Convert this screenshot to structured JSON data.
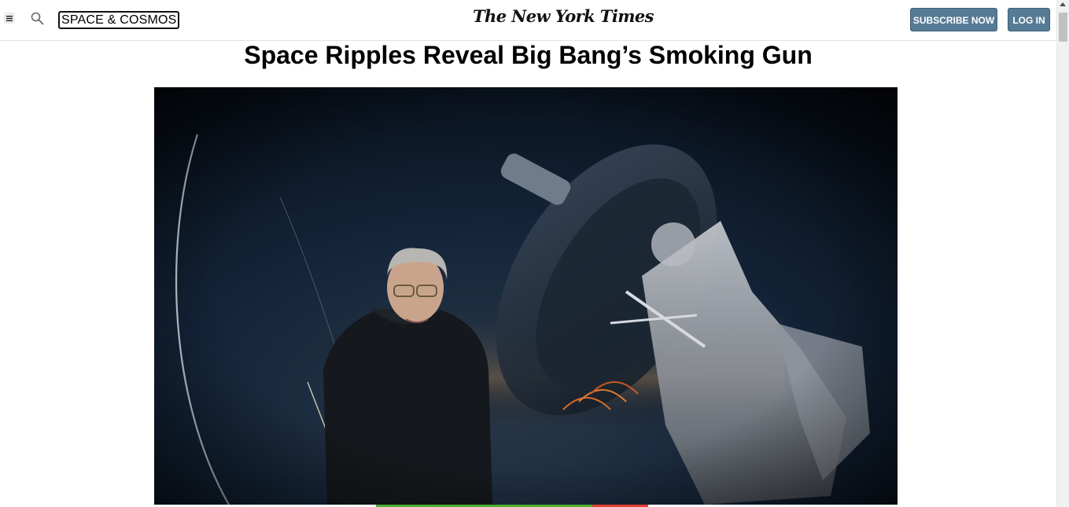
{
  "header": {
    "section_label": "SPACE & COSMOS",
    "logo_text": "The New York Times",
    "subscribe_label": "SUBSCRIBE NOW",
    "login_label": "LOG IN"
  },
  "article": {
    "headline": "Space Ripples Reveal Big Bang’s Smoking Gun"
  },
  "colors": {
    "button_bg": "#567b95",
    "progress_green": "#4caf32",
    "progress_red": "#e0402e"
  },
  "icons": {
    "menu": "hamburger-menu-icon",
    "search": "search-icon"
  }
}
